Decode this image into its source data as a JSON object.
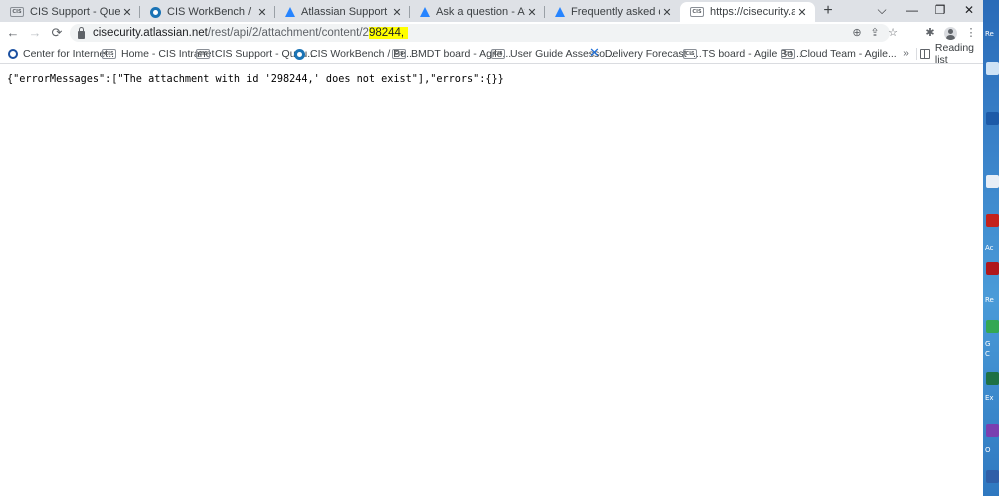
{
  "browser": {
    "tabs": [
      {
        "title": "CIS Support - Queues - Serv",
        "favicon": "cis-favicon",
        "active": false
      },
      {
        "title": "CIS WorkBench / Benchmark",
        "favicon": "workbench-favicon",
        "active": false
      },
      {
        "title": "Atlassian Support",
        "favicon": "atlassian-favicon",
        "active": false
      },
      {
        "title": "Ask a question - Atlassian C",
        "favicon": "atlassian-favicon",
        "active": false
      },
      {
        "title": "Frequently asked questions",
        "favicon": "atlassian-favicon",
        "active": false
      },
      {
        "title": "https://cisecurity.atlassian.n",
        "favicon": "cis-favicon",
        "active": true
      }
    ],
    "new_tab_label": "+",
    "window_controls": {
      "tab_search": "⌵",
      "minimize": "—",
      "restore": "❐",
      "close": "✕"
    },
    "toolbar": {
      "back": "←",
      "forward": "→",
      "reload": "⟳"
    },
    "address": {
      "host": "cisecurity.atlassian.net",
      "path_prefix": "/rest/api/2/attachment/content/2",
      "path_highlighted": "98244,",
      "highlight_color": "#ffff00"
    },
    "omnibox_icons": {
      "zoom": "⊕",
      "share": "⇪",
      "bookmark": "☆"
    },
    "extensions_icon": "✱",
    "menu_icon": "⋮",
    "bookmarks": [
      {
        "label": "Center for Internet...",
        "favicon": "cis-ring-favicon"
      },
      {
        "label": "Home - CIS Intranet",
        "favicon": "cis-favicon"
      },
      {
        "label": "CIS Support - Queu...",
        "favicon": "cis-favicon"
      },
      {
        "label": "CIS WorkBench / Be...",
        "favicon": "workbench-favicon"
      },
      {
        "label": "BMDT board - Agile...",
        "favicon": "cis-favicon"
      },
      {
        "label": "User Guide Assesso...",
        "favicon": "cis-favicon"
      },
      {
        "label": "Delivery Forecast -...",
        "favicon": "confluence-favicon"
      },
      {
        "label": "TS board - Agile Bo...",
        "favicon": "cis-favicon"
      },
      {
        "label": "Cloud Team - Agile...",
        "favicon": "cis-favicon"
      }
    ],
    "bookmarks_overflow": "»",
    "reading_list": "Reading list"
  },
  "page": {
    "body_text": "{\"errorMessages\":[\"The attachment with id '298244,' does not exist\"],\"errors\":{}}"
  },
  "desktop": {
    "labels": [
      "Re",
      "Ac",
      "Re",
      "G",
      "C",
      "Ex",
      "O"
    ]
  },
  "colors": {
    "tabstrip": "#dee1e6",
    "omnibox": "#f1f3f4",
    "accent_blue": "#2684ff",
    "desktop": "#3a82c9"
  }
}
